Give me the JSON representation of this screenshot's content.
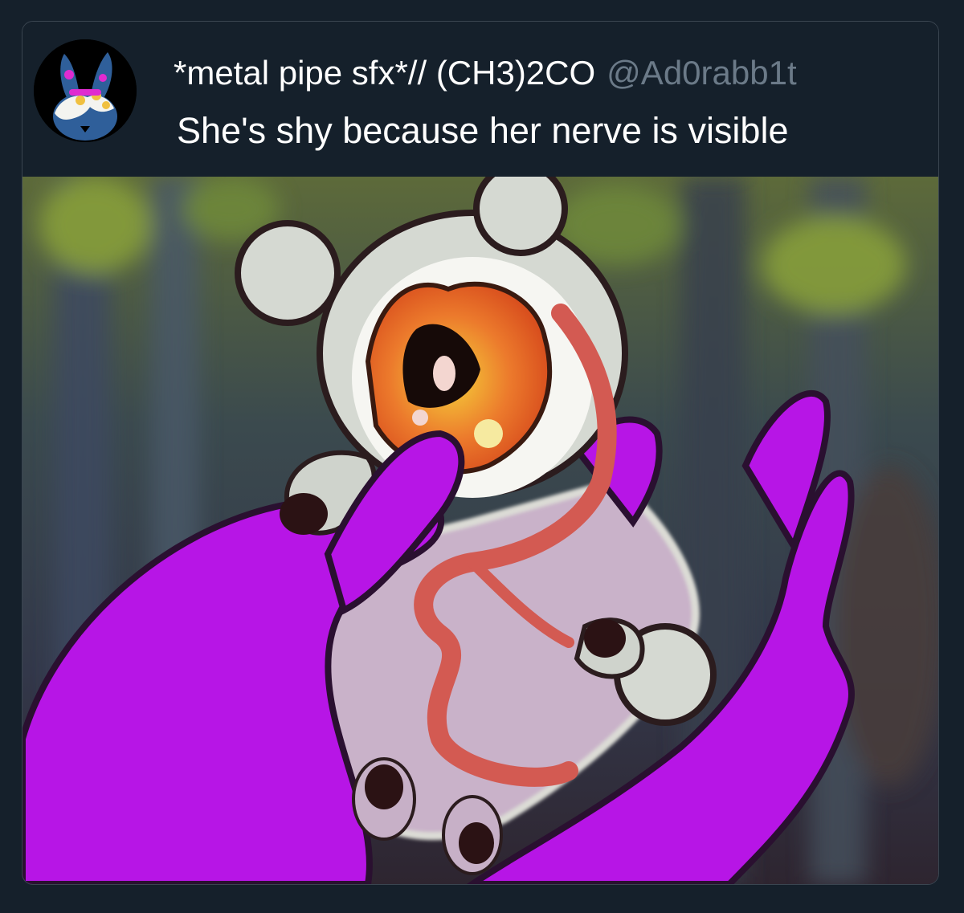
{
  "tweet": {
    "display_name": "*metal pipe sfx*// (CH3)2CO",
    "handle": "@Ad0rabb1t",
    "text": "She's shy because her nerve is visible",
    "avatar_icon": "bunny-avatar-icon",
    "image_description_icon": "creature-in-hands-artwork"
  },
  "colors": {
    "background": "#15202b",
    "name": "#ffffff",
    "handle": "#6b7a88",
    "hand": "#b715e6",
    "nerve": "#d35a52",
    "eye_orange": "#ec7a2c"
  }
}
